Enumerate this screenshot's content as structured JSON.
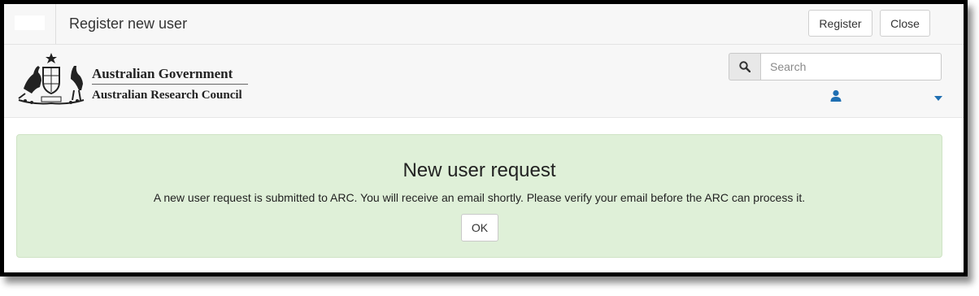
{
  "titlebar": {
    "title": "Register new user",
    "register_label": "Register",
    "close_label": "Close"
  },
  "header": {
    "logo_line1": "Australian Government",
    "logo_line2": "Australian Research Council",
    "search": {
      "placeholder": "Search",
      "icon": "search-icon"
    },
    "user_menu": {
      "icon": "user-icon",
      "caret": "caret-down-icon"
    }
  },
  "alert": {
    "heading": "New user request",
    "message": "A new user request is submitted to ARC. You will receive an email shortly. Please verify your email before the ARC can process it.",
    "ok_label": "OK"
  },
  "colors": {
    "alert_bg": "#dff0d8",
    "accent_blue": "#1f6fb2"
  }
}
